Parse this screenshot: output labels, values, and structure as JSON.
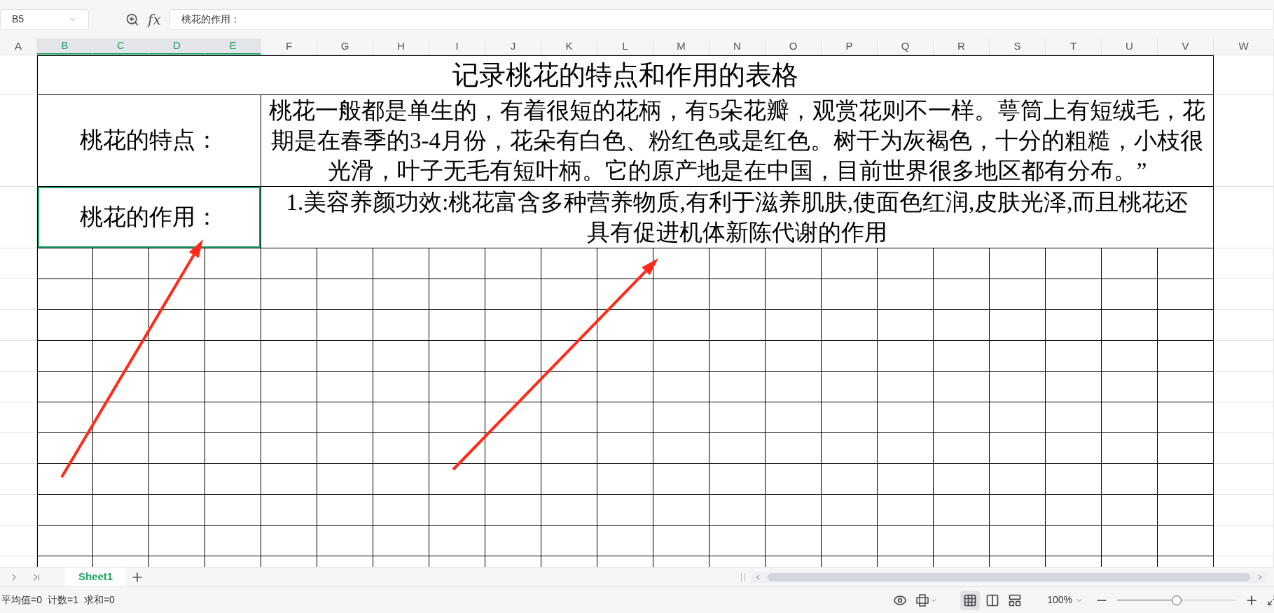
{
  "name_box": "B5",
  "fx_label": "fx",
  "formula": "桃花的作用：",
  "columns": [
    {
      "label": "A",
      "selected": false
    },
    {
      "label": "B",
      "selected": true
    },
    {
      "label": "C",
      "selected": true
    },
    {
      "label": "D",
      "selected": true
    },
    {
      "label": "E",
      "selected": true
    },
    {
      "label": "F",
      "selected": false
    },
    {
      "label": "G",
      "selected": false
    },
    {
      "label": "H",
      "selected": false
    },
    {
      "label": "I",
      "selected": false
    },
    {
      "label": "J",
      "selected": false
    },
    {
      "label": "K",
      "selected": false
    },
    {
      "label": "L",
      "selected": false
    },
    {
      "label": "M",
      "selected": false
    },
    {
      "label": "N",
      "selected": false
    },
    {
      "label": "O",
      "selected": false
    },
    {
      "label": "P",
      "selected": false
    },
    {
      "label": "Q",
      "selected": false
    },
    {
      "label": "R",
      "selected": false
    },
    {
      "label": "S",
      "selected": false
    },
    {
      "label": "T",
      "selected": false
    },
    {
      "label": "U",
      "selected": false
    },
    {
      "label": "V",
      "selected": false
    },
    {
      "label": "W",
      "selected": false
    }
  ],
  "title": "记录桃花的特点和作用的表格",
  "rows": [
    {
      "label": "桃花的特点：",
      "selected": false,
      "lines": [
        "桃花一般都是单生的，有着很短的花柄，有5朵花瓣，观赏花则不一样。萼筒上有短绒毛，花",
        "期是在春季的3-4月份，花朵有白色、粉红色或是红色。树干为灰褐色，十分的粗糙，小枝很",
        "光滑，叶子无毛有短叶柄。它的原产地是在中国，目前世界很多地区都有分布。”"
      ]
    },
    {
      "label": "桃花的作用：",
      "selected": true,
      "lines": [
        "1.美容养颜功效:桃花富含多种营养物质,有利于滋养肌肤,使面色红润,皮肤光泽,而且桃花还",
        "具有促进机体新陈代谢的作用"
      ]
    }
  ],
  "sheet_tabs": [
    {
      "label": "Sheet1",
      "selected": true
    }
  ],
  "status": [
    "平均值=0",
    "计数=1",
    "求和=0"
  ],
  "views": [
    {
      "kind": "normal",
      "selected": true
    },
    {
      "kind": "page",
      "selected": false
    },
    {
      "kind": "pagebreak",
      "selected": false
    }
  ],
  "zoom": {
    "label": "100%",
    "level": 0.5
  }
}
